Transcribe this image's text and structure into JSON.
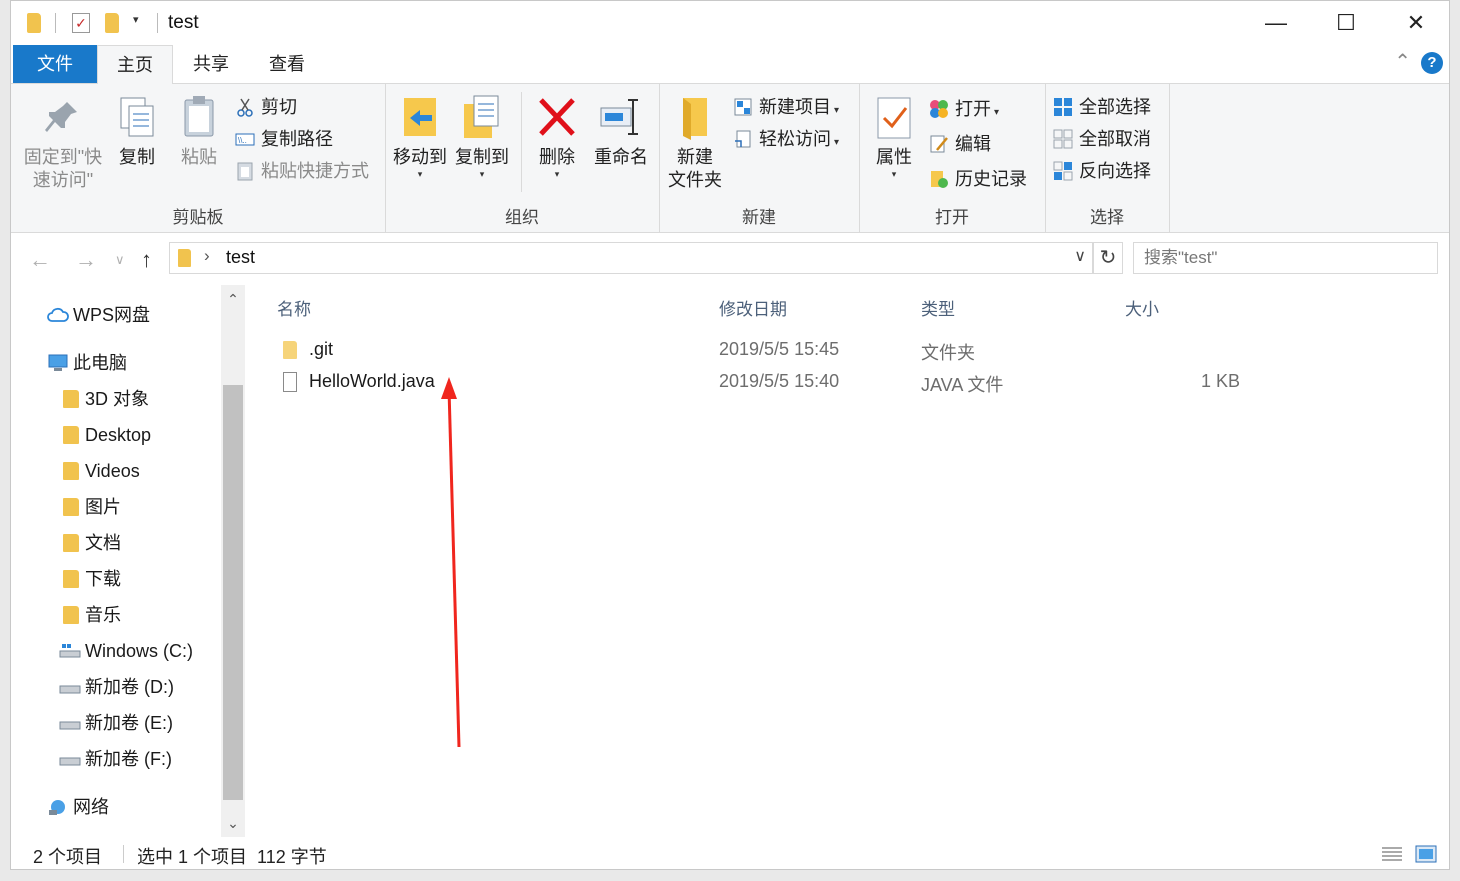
{
  "window": {
    "title": "test",
    "controls": {
      "minimize": "—",
      "maximize": "☐",
      "close": "✕"
    }
  },
  "ribbon": {
    "tabs": [
      "文件",
      "主页",
      "共享",
      "查看"
    ],
    "clipboard": {
      "label": "剪贴板",
      "pin": [
        "固定到\"快",
        "速访问\""
      ],
      "copy": "复制",
      "paste": "粘贴",
      "cut": "剪切",
      "copy_path": "复制路径",
      "paste_shortcut": "粘贴快捷方式"
    },
    "organize": {
      "label": "组织",
      "move_to": "移动到",
      "copy_to": "复制到",
      "delete": "删除",
      "rename": "重命名"
    },
    "new": {
      "label": "新建",
      "new_folder": [
        "新建",
        "文件夹"
      ],
      "new_item": "新建项目",
      "easy_access": "轻松访问"
    },
    "open": {
      "label": "打开",
      "properties": "属性",
      "open": "打开",
      "edit": "编辑",
      "history": "历史记录"
    },
    "select": {
      "label": "选择",
      "select_all": "全部选择",
      "select_none": "全部取消",
      "invert": "反向选择"
    }
  },
  "address": {
    "path": "test",
    "search_placeholder": "搜索\"test\""
  },
  "nav": {
    "items": [
      {
        "label": "WPS网盘",
        "icon": "cloud-icon"
      },
      {
        "label": "此电脑",
        "icon": "computer-icon"
      },
      {
        "label": "3D 对象",
        "icon": "folder-icon"
      },
      {
        "label": "Desktop",
        "icon": "folder-icon"
      },
      {
        "label": "Videos",
        "icon": "folder-icon"
      },
      {
        "label": "图片",
        "icon": "folder-icon"
      },
      {
        "label": "文档",
        "icon": "folder-icon"
      },
      {
        "label": "下载",
        "icon": "folder-icon"
      },
      {
        "label": "音乐",
        "icon": "folder-icon"
      },
      {
        "label": "Windows (C:)",
        "icon": "drive-icon"
      },
      {
        "label": "新加卷 (D:)",
        "icon": "drive-icon"
      },
      {
        "label": "新加卷 (E:)",
        "icon": "drive-icon"
      },
      {
        "label": "新加卷 (F:)",
        "icon": "drive-icon"
      },
      {
        "label": "网络",
        "icon": "network-icon"
      }
    ]
  },
  "files": {
    "columns": [
      "名称",
      "修改日期",
      "类型",
      "大小"
    ],
    "rows": [
      {
        "name": ".git",
        "modified": "2019/5/5 15:45",
        "type": "文件夹",
        "size": "",
        "icon": "folder-icon"
      },
      {
        "name": "HelloWorld.java",
        "modified": "2019/5/5 15:40",
        "type": "JAVA 文件",
        "size": "1 KB",
        "icon": "file-icon"
      }
    ]
  },
  "status": {
    "count": "2 个项目",
    "selection": "选中 1 个项目  112 字节"
  },
  "colors": {
    "accent": "#1979ca",
    "annotation_arrow": "#f0261e"
  }
}
